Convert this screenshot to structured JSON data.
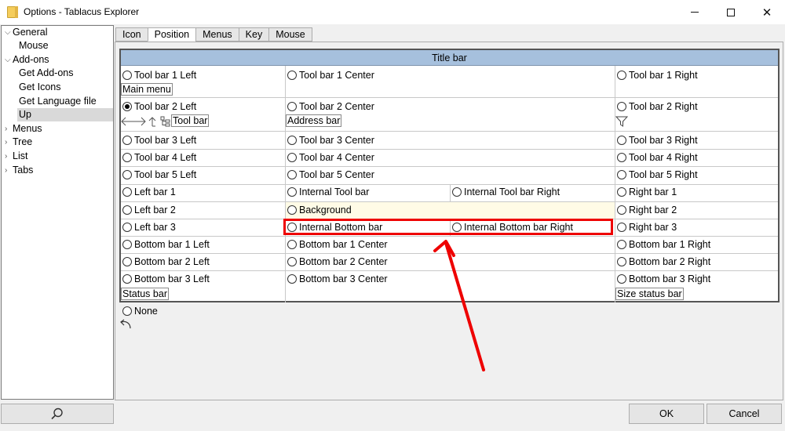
{
  "window": {
    "title": "Options - Tablacus Explorer",
    "min_icon": "minimize-icon",
    "max_icon": "maximize-icon",
    "close_icon": "close-icon",
    "close_glyph": "✕"
  },
  "sidebar": {
    "items": [
      {
        "label": "General",
        "chev": "⌵"
      },
      {
        "label": "Mouse",
        "chev": ""
      },
      {
        "label": "Add-ons",
        "chev": "⌵"
      },
      {
        "label": "Get Add-ons",
        "chev": ""
      },
      {
        "label": "Get Icons",
        "chev": ""
      },
      {
        "label": "Get Language file",
        "chev": ""
      },
      {
        "label": "Up",
        "chev": ""
      },
      {
        "label": "Menus",
        "chev": "›"
      },
      {
        "label": "Tree",
        "chev": "›"
      },
      {
        "label": "List",
        "chev": "›"
      },
      {
        "label": "Tabs",
        "chev": "›"
      }
    ],
    "selected": "Up",
    "search_icon": "search-icon"
  },
  "tabs": [
    "Icon",
    "Position",
    "Menus",
    "Key",
    "Mouse"
  ],
  "active_tab": "Position",
  "grid": {
    "title_bar": "Title bar",
    "toolbar1": {
      "left": "Tool bar 1 Left",
      "center": "Tool bar 1 Center",
      "right": "Tool bar 1 Right",
      "left_item": "Main menu"
    },
    "toolbar2": {
      "left": "Tool bar 2 Left",
      "center": "Tool bar 2 Center",
      "right": "Tool bar 2 Right",
      "left_item": "Tool bar",
      "center_item": "Address bar"
    },
    "toolbar3": {
      "left": "Tool bar 3 Left",
      "center": "Tool bar 3 Center",
      "right": "Tool bar 3 Right"
    },
    "toolbar4": {
      "left": "Tool bar 4 Left",
      "center": "Tool bar 4 Center",
      "right": "Tool bar 4 Right"
    },
    "toolbar5": {
      "left": "Tool bar 5 Left",
      "center": "Tool bar 5 Center",
      "right": "Tool bar 5 Right"
    },
    "row_bar1": {
      "left": "Left bar 1",
      "center": "Internal Tool bar",
      "center_right": "Internal Tool bar Right",
      "right": "Right bar 1"
    },
    "row_bar2": {
      "left": "Left bar 2",
      "center": "Background",
      "right": "Right bar 2"
    },
    "row_bar3": {
      "left": "Left bar 3",
      "center": "Internal Bottom bar",
      "center_right": "Internal Bottom bar Right",
      "right": "Right bar 3"
    },
    "bottombar1": {
      "left": "Bottom bar 1 Left",
      "center": "Bottom bar 1 Center",
      "right": "Bottom bar 1 Right"
    },
    "bottombar2": {
      "left": "Bottom bar 2 Left",
      "center": "Bottom bar 2 Center",
      "right": "Bottom bar 2 Right"
    },
    "bottombar3": {
      "left": "Bottom bar 3 Left",
      "center": "Bottom bar 3 Center",
      "right": "Bottom bar 3 Right",
      "left_item": "Status bar",
      "right_item": "Size status bar"
    },
    "selected": "Tool bar 2 Left"
  },
  "none_label": "None",
  "buttons": {
    "ok": "OK",
    "cancel": "Cancel"
  },
  "colors": {
    "title_bar_bg": "#a6c0dd",
    "highlight": "#ee0000",
    "background_cell": "#fffbe6"
  }
}
